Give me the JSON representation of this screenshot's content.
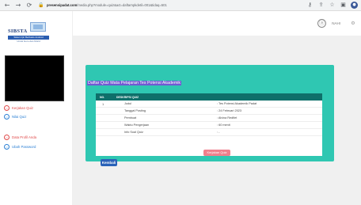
{
  "browser": {
    "back_glyph": "←",
    "forward_glyph": "→",
    "reload_glyph": "⟳",
    "lock_glyph": "🔒",
    "url_domain": "presensipadat.com",
    "url_path": "/media.php?module=quiz&act=daftarnpkdetil=001&tidaq=501",
    "icons": [
      "key-icon",
      "share-icon",
      "star-icon",
      "extensions-icon",
      "profile-icon"
    ],
    "icon_glyphs": [
      "⚷",
      "⇪",
      "☆",
      "▣",
      "●"
    ]
  },
  "logo": {
    "title": "SIBSTA",
    "band_text": "Sistem Ijin Berbasis Android",
    "subtitle": "Untuk Guru dan Murid"
  },
  "sidebar": {
    "items": [
      {
        "label": "Kerjakan Quiz",
        "icon_glyph": "○",
        "color": "#e04a4a"
      },
      {
        "label": "Nilai Quiz",
        "icon_glyph": "○",
        "color": "#2a7fd4"
      },
      {
        "label": "Data Profil Anda",
        "icon_glyph": "○",
        "color": "#e04a4a"
      },
      {
        "label": "Ubah Password",
        "icon_glyph": "○",
        "color": "#2a7fd4"
      }
    ]
  },
  "header": {
    "avatar_glyph": "ⓐ",
    "user_name": "NAHI",
    "settings_glyph": "⚙"
  },
  "main": {
    "card_title": "Daftar Quiz Mata Pelajaran Tes Potensi Akademik",
    "columns": [
      "NO.",
      "DESKRIPSI QUIZ"
    ],
    "row_number": "1",
    "rows": [
      {
        "label": "Judul",
        "value": ": Tes Potensi Akademik Padat"
      },
      {
        "label": "Tanggal Posting",
        "value": ": 24 Februari 2023"
      },
      {
        "label": "Pembuat",
        "value": ": Alvina Redfiet"
      },
      {
        "label": "Waktu Pengerjaan",
        "value": ": 60 menit"
      },
      {
        "label": "Info Soal Quiz",
        "value": ": -"
      }
    ],
    "submit_label": "Kerjakan Quiz",
    "back_label": "Kembali"
  },
  "colors": {
    "card_bg": "#2fc7b2",
    "table_header": "#0f6f6a",
    "submit_button": "#f17f8c",
    "back_button": "#2a62b8"
  }
}
